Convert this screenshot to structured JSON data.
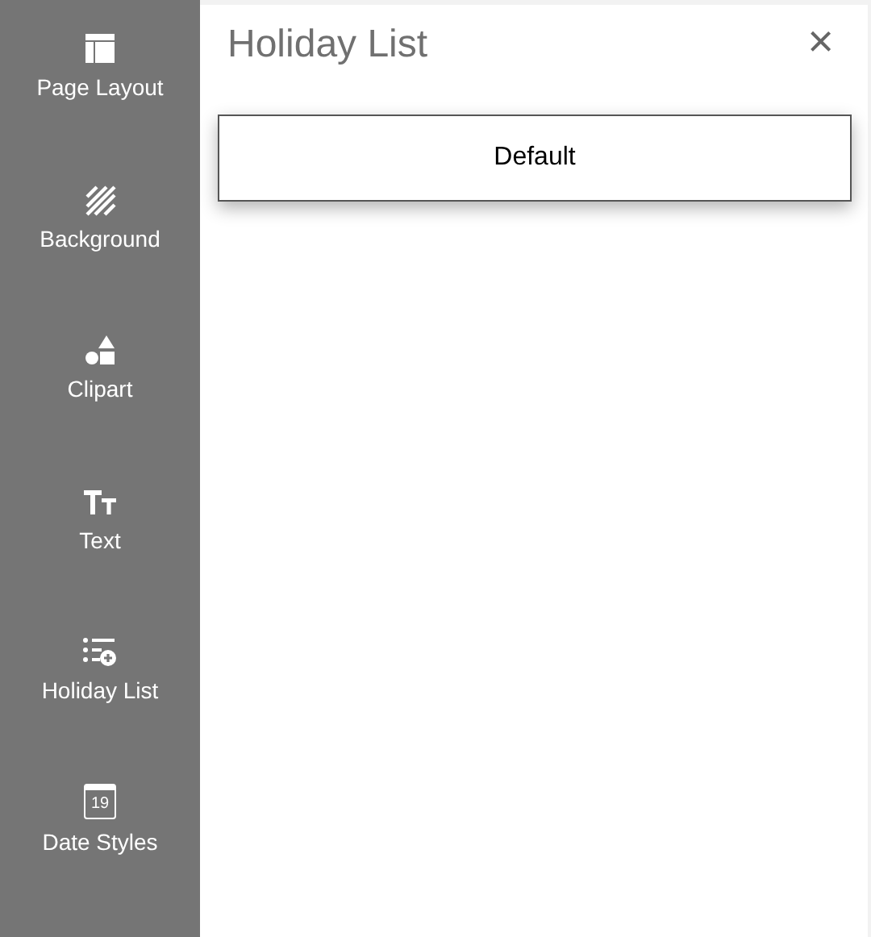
{
  "sidebar": {
    "items": [
      {
        "kind": "layout",
        "label": "Page Layout"
      },
      {
        "kind": "background",
        "label": "Background"
      },
      {
        "kind": "clipart",
        "label": "Clipart"
      },
      {
        "kind": "text",
        "label": "Text"
      },
      {
        "kind": "holiday",
        "label": "Holiday List"
      },
      {
        "kind": "date",
        "label": "Date Styles",
        "icon_text": "19"
      }
    ]
  },
  "panel": {
    "title": "Holiday List",
    "close": "×",
    "options": [
      "Default"
    ]
  }
}
